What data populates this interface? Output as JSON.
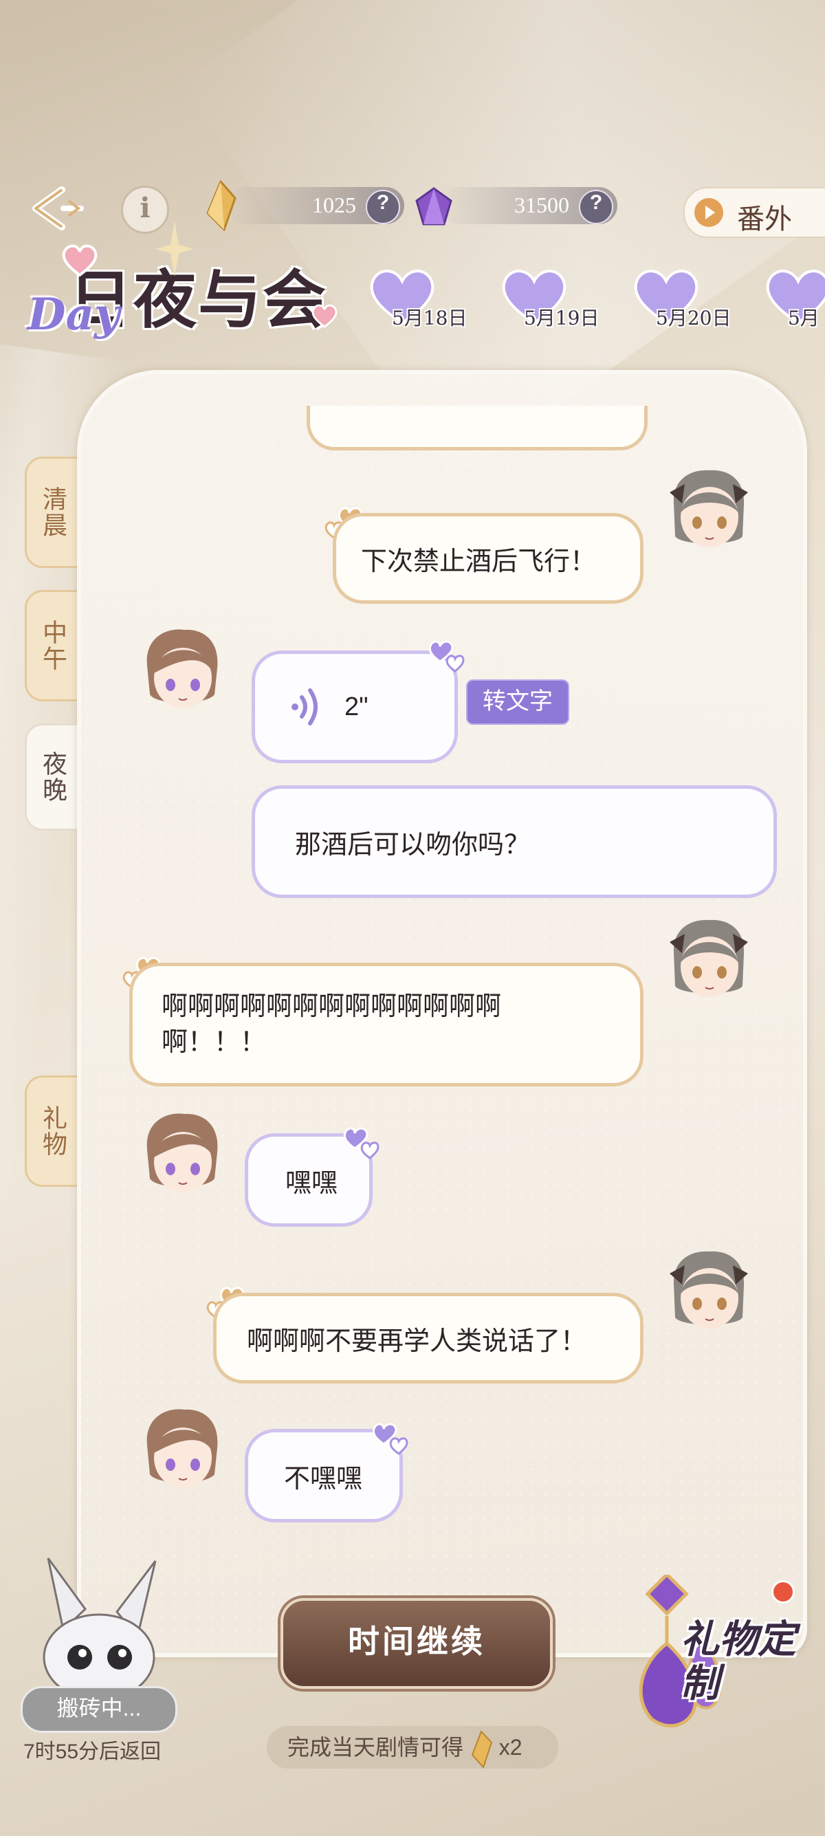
{
  "header": {
    "gold_amount": "1025",
    "gem_amount": "31500",
    "help_glyph": "?",
    "info_glyph": "i",
    "extra_button": "番外"
  },
  "logo": {
    "title": "日夜与会",
    "day_tag": "Day"
  },
  "dates": [
    "5月18日",
    "5月19日",
    "5月20日",
    "5月"
  ],
  "side_tabs": {
    "morning": "清晨",
    "noon": "中午",
    "night": "夜晚",
    "gift": "礼物"
  },
  "chat": {
    "m1": "下次禁止酒后飞行！",
    "voice_duration": "2\"",
    "convert_label": "转文字",
    "h2": "那酒后可以吻你吗？",
    "m3": "啊啊啊啊啊啊啊啊啊啊啊啊啊啊！！！",
    "h3": "嘿嘿",
    "m4": "啊啊啊不要再学人类说话了！",
    "h4": "不嘿嘿"
  },
  "footer": {
    "continue_label": "时间继续",
    "reward_text": "完成当天剧情可得",
    "reward_mult": "x2",
    "busy_label": "搬砖中...",
    "return_text": "7时55分后返回",
    "gift_custom_label": "礼物定制"
  },
  "colors": {
    "mine_border": "#e6c9a0",
    "his_border": "#cfc2ef",
    "accent_purple": "#8f79d6",
    "continue_brown": "#6b4a3c"
  }
}
